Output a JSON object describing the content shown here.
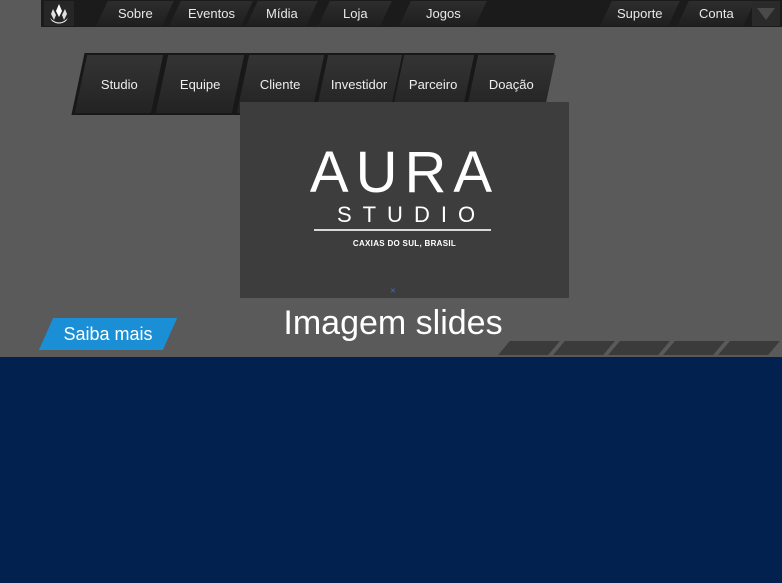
{
  "top_nav": {
    "items": [
      {
        "label": "Sobre"
      },
      {
        "label": "Eventos"
      },
      {
        "label": "Mídia"
      },
      {
        "label": "Loja"
      },
      {
        "label": "Jogos"
      }
    ],
    "right_items": [
      {
        "label": "Suporte"
      },
      {
        "label": "Conta"
      }
    ],
    "logo_icon": "crystal-logo-icon",
    "dropdown_icon": "triangle-down-icon"
  },
  "sub_nav": {
    "items": [
      {
        "label": "Studio"
      },
      {
        "label": "Equipe"
      },
      {
        "label": "Cliente"
      },
      {
        "label": "Investidor"
      },
      {
        "label": "Parceiro"
      },
      {
        "label": "Doação"
      }
    ]
  },
  "slide": {
    "brand": "AURA",
    "subtitle": "STUDIO",
    "location": "CAXIAS DO SUL, BRASIL",
    "caption": "Imagem slides",
    "cta_label": "Saiba mais",
    "indicator_count": 5
  },
  "colors": {
    "top_bar": "#1b1b1b",
    "header_bg": "#5a5a5a",
    "slide_bg": "#3d3d3d",
    "accent": "#1a8fd6",
    "content_bg": "#03214f"
  }
}
